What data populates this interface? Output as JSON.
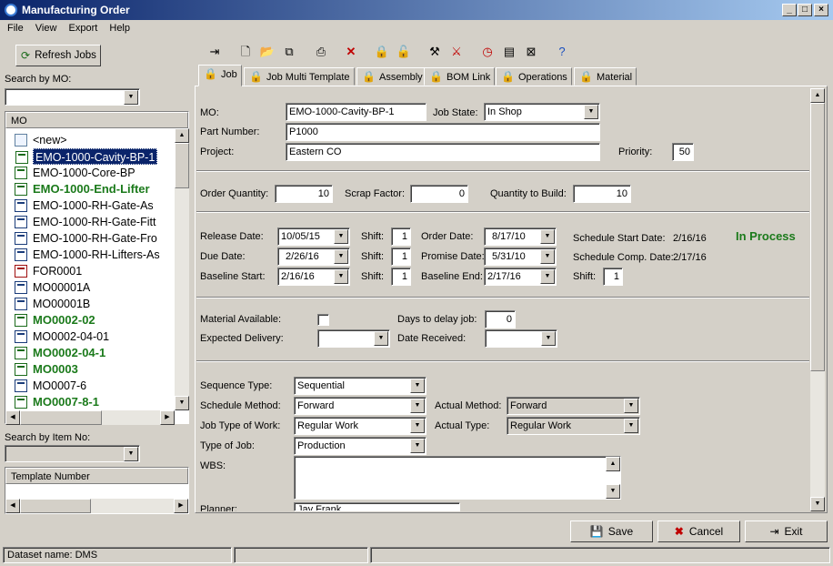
{
  "window": {
    "title": "Manufacturing Order"
  },
  "menu": [
    "File",
    "View",
    "Export",
    "Help"
  ],
  "left": {
    "refresh_label": "Refresh Jobs",
    "search_mo_label": "Search by MO:",
    "mo_header": "MO",
    "items": [
      {
        "label": "<new>",
        "style": "normal",
        "icon": "doc"
      },
      {
        "label": "EMO-1000-Cavity-BP-1",
        "style": "selected",
        "icon": "g"
      },
      {
        "label": "EMO-1000-Core-BP",
        "style": "normal",
        "icon": "g"
      },
      {
        "label": "EMO-1000-End-Lifter",
        "style": "bold",
        "icon": "g"
      },
      {
        "label": "EMO-1000-RH-Gate-As",
        "style": "normal",
        "icon": "b"
      },
      {
        "label": "EMO-1000-RH-Gate-Fitt",
        "style": "normal",
        "icon": "b"
      },
      {
        "label": "EMO-1000-RH-Gate-Fro",
        "style": "normal",
        "icon": "b"
      },
      {
        "label": "EMO-1000-RH-Lifters-As",
        "style": "normal",
        "icon": "b"
      },
      {
        "label": "FOR0001",
        "style": "normal",
        "icon": "r"
      },
      {
        "label": "MO00001A",
        "style": "normal",
        "icon": "b"
      },
      {
        "label": "MO00001B",
        "style": "normal",
        "icon": "b"
      },
      {
        "label": "MO0002-02",
        "style": "bold",
        "icon": "g"
      },
      {
        "label": "MO0002-04-01",
        "style": "normal",
        "icon": "b"
      },
      {
        "label": "MO0002-04-1",
        "style": "bold",
        "icon": "g"
      },
      {
        "label": "MO0003",
        "style": "bold",
        "icon": "g"
      },
      {
        "label": "MO0007-6",
        "style": "normal",
        "icon": "b"
      },
      {
        "label": "MO0007-8-1",
        "style": "bold",
        "icon": "g"
      }
    ],
    "search_item_label": "Search by Item No:",
    "template_header": "Template Number"
  },
  "tabs": [
    "Job",
    "Job Multi Template",
    "Assembly",
    "BOM Link",
    "Operations",
    "Material"
  ],
  "form": {
    "mo_label": "MO:",
    "mo": "EMO-1000-Cavity-BP-1",
    "job_state_label": "Job State:",
    "job_state": "In Shop",
    "part_label": "Part Number:",
    "part": "P1000",
    "project_label": "Project:",
    "project": "Eastern CO",
    "priority_label": "Priority:",
    "priority": "50",
    "order_qty_label": "Order Quantity:",
    "order_qty": "10",
    "scrap_label": "Scrap Factor:",
    "scrap": "0",
    "qty_build_label": "Quantity to Build:",
    "qty_build": "10",
    "release_label": "Release Date:",
    "release": "10/05/15",
    "due_label": "Due Date:",
    "due": "2/26/16",
    "baseline_start_label": "Baseline Start:",
    "baseline_start": "2/16/16",
    "shift_label": "Shift:",
    "shift1": "1",
    "shift2": "1",
    "shift3": "1",
    "shift4": "1",
    "order_date_label": "Order Date:",
    "order_date": "8/17/10",
    "promise_label": "Promise Date:",
    "promise": "5/31/10",
    "baseline_end_label": "Baseline End:",
    "baseline_end": "2/17/16",
    "sched_start_label": "Schedule Start Date:",
    "sched_start": "2/16/16",
    "sched_comp_label": "Schedule Comp. Date:",
    "sched_comp": "2/17/16",
    "status": "In Process",
    "mat_avail_label": "Material Available:",
    "days_delay_label": "Days to delay job:",
    "days_delay": "0",
    "exp_delivery_label": "Expected Delivery:",
    "date_received_label": "Date Received:",
    "seq_type_label": "Sequence Type:",
    "seq_type": "Sequential",
    "sched_method_label": "Schedule Method:",
    "sched_method": "Forward",
    "actual_method_label": "Actual Method:",
    "actual_method": "Forward",
    "job_type_work_label": "Job Type of Work:",
    "job_type_work": "Regular Work",
    "actual_type_label": "Actual Type:",
    "actual_type": "Regular Work",
    "type_job_label": "Type of Job:",
    "type_job": "Production",
    "wbs_label": "WBS:",
    "planner_label": "Planner:",
    "planner": "Jay Frank"
  },
  "buttons": {
    "save": "Save",
    "cancel": "Cancel",
    "exit": "Exit"
  },
  "status": {
    "dataset": "Dataset name:  DMS"
  }
}
